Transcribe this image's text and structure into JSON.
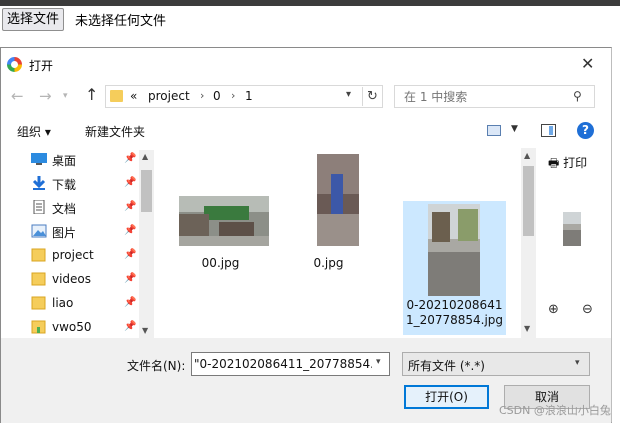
{
  "page": {
    "choose_file_button": "选择文件",
    "no_file_text": "未选择任何文件"
  },
  "dialog": {
    "title": "打开",
    "nav": {
      "back_icon": "arrow-left",
      "forward_icon": "arrow-right",
      "up_icon": "arrow-up",
      "breadcrumb_prefix": "«",
      "breadcrumb": [
        "project",
        "0",
        "1"
      ],
      "search_placeholder": "在 1 中搜索"
    },
    "toolbar": {
      "organize": "组织 ▾",
      "new_folder": "新建文件夹"
    },
    "sidebar": {
      "items": [
        {
          "label": "桌面",
          "icon": "desktop"
        },
        {
          "label": "下载",
          "icon": "download"
        },
        {
          "label": "文档",
          "icon": "document"
        },
        {
          "label": "图片",
          "icon": "pictures"
        },
        {
          "label": "project",
          "icon": "folder"
        },
        {
          "label": "videos",
          "icon": "folder"
        },
        {
          "label": "liao",
          "icon": "folder"
        },
        {
          "label": "vwo50",
          "icon": "folder"
        }
      ]
    },
    "files": [
      {
        "name": "00.jpg",
        "selected": false
      },
      {
        "name": "0.jpg",
        "selected": false
      },
      {
        "name": "0-20210208641\n1_20778854.jpg",
        "selected": true
      },
      {
        "name": "",
        "selected": true
      },
      {
        "name": "",
        "selected": true
      },
      {
        "name": "",
        "selected": false
      }
    ],
    "preview": {
      "print_label": "打印"
    },
    "bottom": {
      "filename_label": "文件名(N):",
      "filename_value": "\"0-202102086411_20778854.jp",
      "filetype_value": "所有文件 (*.*)",
      "open_button": "打开(O)",
      "cancel_button": "取消"
    }
  },
  "watermark": "CSDN @浪浪山小白兔",
  "colors": {
    "selection": "#cce8ff",
    "accent": "#0078d7",
    "folder": "#f5cd5b"
  }
}
